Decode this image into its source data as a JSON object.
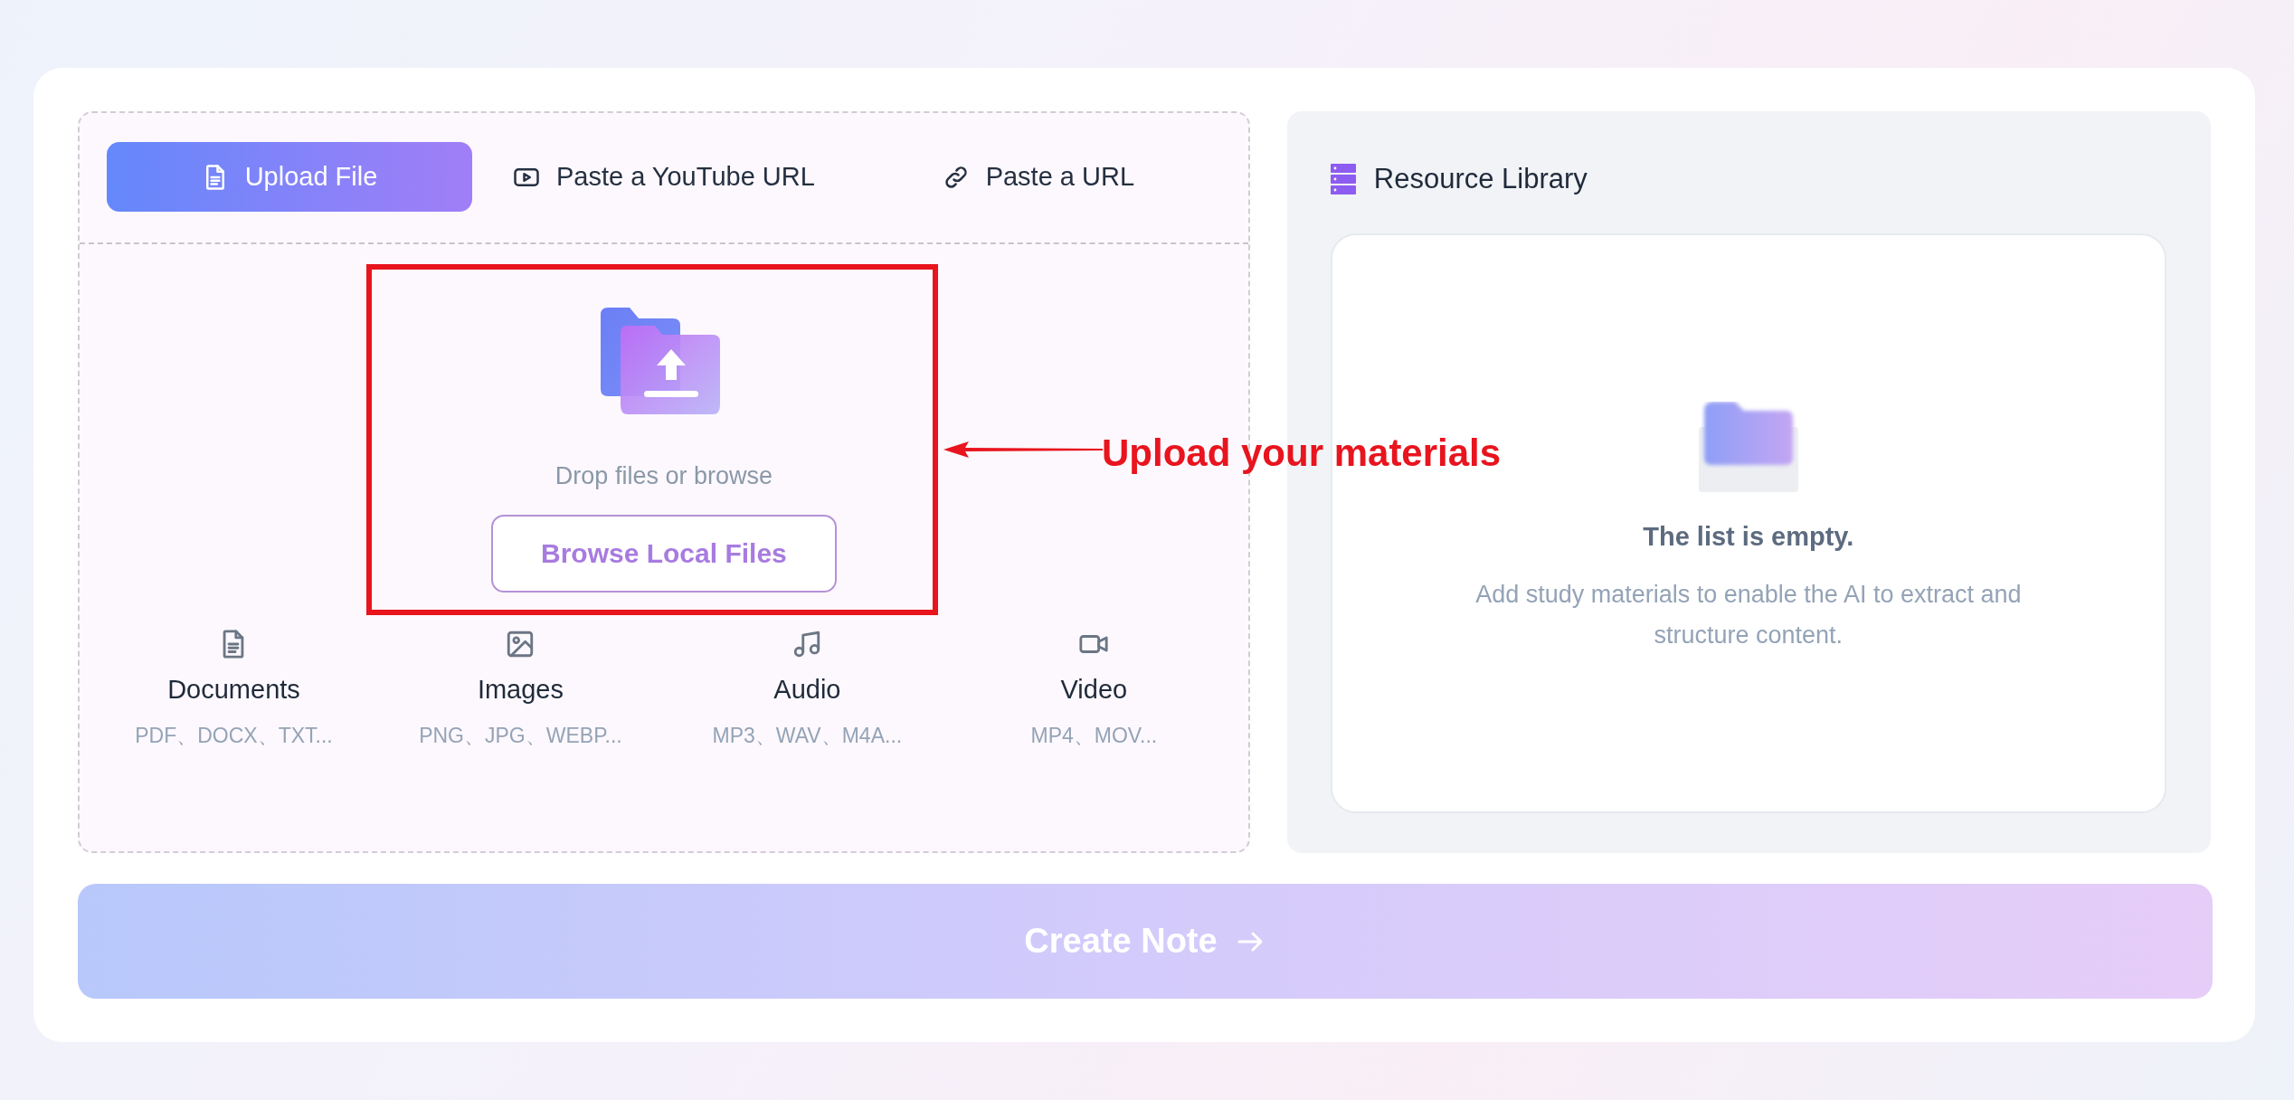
{
  "source_tabs": [
    {
      "label": "Upload File",
      "kind": "document",
      "selected": true
    },
    {
      "label": "Paste a YouTube URL",
      "kind": "video",
      "selected": false
    },
    {
      "label": "Paste a URL",
      "kind": "link",
      "selected": false
    }
  ],
  "upload": {
    "hint": "Drop files or browse",
    "browse_button": "Browse Local Files"
  },
  "file_types": [
    {
      "kind": "document",
      "label": "Documents",
      "formats": "PDF、DOCX、TXT..."
    },
    {
      "kind": "image",
      "label": "Images",
      "formats": "PNG、JPG、WEBP..."
    },
    {
      "kind": "audio",
      "label": "Audio",
      "formats": "MP3、WAV、M4A..."
    },
    {
      "kind": "video",
      "label": "Video",
      "formats": "MP4、MOV..."
    }
  ],
  "annotation": {
    "text": "Upload your materials"
  },
  "resource_library": {
    "title": "Resource Library",
    "empty_title": "The list is empty.",
    "empty_description": "Add study materials to enable the AI to extract and structure content."
  },
  "create_button": {
    "label": "Create Note",
    "disabled": true
  }
}
